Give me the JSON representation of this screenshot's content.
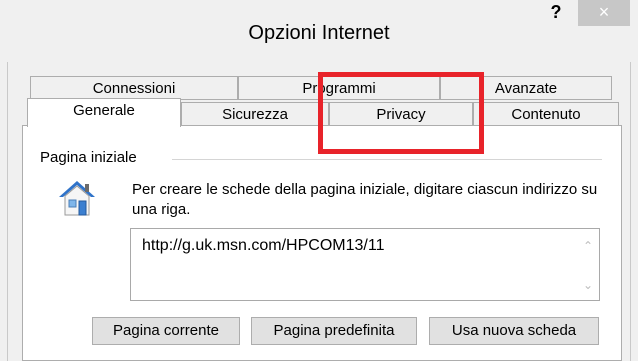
{
  "window": {
    "title": "Opzioni Internet",
    "help_label": "?",
    "close_label": "×"
  },
  "tabs": {
    "row_back": [
      {
        "label": "Connessioni"
      },
      {
        "label": "Programmi"
      },
      {
        "label": "Avanzate"
      }
    ],
    "row_front": [
      {
        "label": "Generale",
        "selected": true
      },
      {
        "label": "Sicurezza"
      },
      {
        "label": "Privacy"
      },
      {
        "label": "Contenuto"
      }
    ]
  },
  "home_page": {
    "group_label": "Pagina iniziale",
    "icon": "house-icon",
    "description": "Per creare le schede della pagina iniziale, digitare ciascun indirizzo su una riga.",
    "url_value": "http://g.uk.msn.com/HPCOM13/11"
  },
  "buttons": {
    "current_page": "Pagina corrente",
    "default_page": "Pagina predefinita",
    "new_tab": "Usa nuova scheda"
  },
  "annotation": {
    "highlight_color": "#e8232a"
  }
}
